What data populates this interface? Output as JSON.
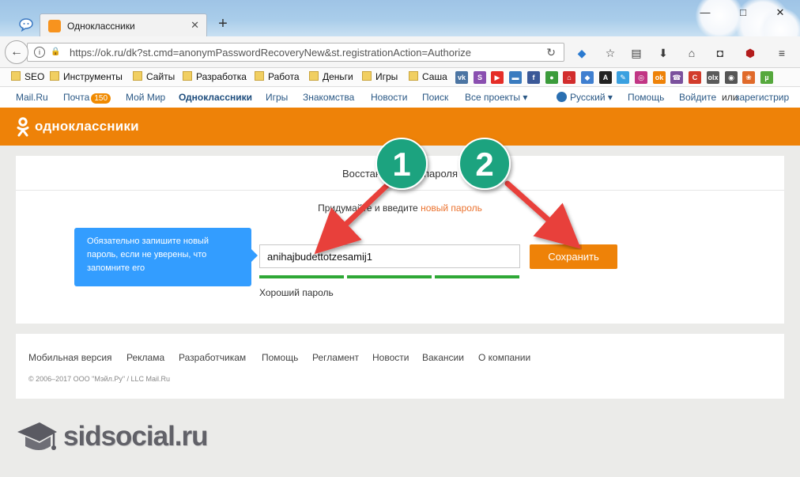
{
  "browser": {
    "tab_title": "Одноклассники",
    "url": "https://ok.ru/dk?st.cmd=anonymPasswordRecoveryNew&st.registrationAction=Authorize",
    "bookmarks": [
      {
        "label": "SEO"
      },
      {
        "label": "Инструменты"
      },
      {
        "label": "Сайты"
      },
      {
        "label": "Разработка"
      },
      {
        "label": "Работа"
      },
      {
        "label": "Деньги"
      },
      {
        "label": "Игры"
      },
      {
        "label": "Саша"
      }
    ],
    "bookmark_icons": [
      {
        "name": "vk-icon",
        "glyph": "vk",
        "color": "#4c75a3"
      },
      {
        "name": "skype-s-icon",
        "glyph": "S",
        "color": "#8a4fb0"
      },
      {
        "name": "youtube-icon",
        "glyph": "▶",
        "color": "#e52d27"
      },
      {
        "name": "card-icon",
        "glyph": "▬",
        "color": "#3a7bbf"
      },
      {
        "name": "facebook-icon",
        "glyph": "f",
        "color": "#3b5998"
      },
      {
        "name": "globe-green-icon",
        "glyph": "●",
        "color": "#3b9b3b"
      },
      {
        "name": "house-icon",
        "glyph": "⌂",
        "color": "#d22d2d"
      },
      {
        "name": "diamond-icon",
        "glyph": "◆",
        "color": "#3f7fd0"
      },
      {
        "name": "a-icon",
        "glyph": "A",
        "color": "#222222"
      },
      {
        "name": "pen-icon",
        "glyph": "✎",
        "color": "#3aa0e0"
      },
      {
        "name": "instagram-icon",
        "glyph": "◎",
        "color": "#c13584"
      },
      {
        "name": "ok-icon",
        "glyph": "ok",
        "color": "#ee8208"
      },
      {
        "name": "viber-icon",
        "glyph": "☎",
        "color": "#7b519d"
      },
      {
        "name": "c-icon",
        "glyph": "C",
        "color": "#d23c2c"
      },
      {
        "name": "olx-icon",
        "glyph": "olx",
        "color": "#5a5a5a"
      },
      {
        "name": "eye-icon",
        "glyph": "◉",
        "color": "#555555"
      },
      {
        "name": "paw-icon",
        "glyph": "❀",
        "color": "#e06a2a"
      },
      {
        "name": "utorrent-icon",
        "glyph": "µ",
        "color": "#56a83d"
      }
    ]
  },
  "mail_bar": {
    "mail_ru": "Mail.Ru",
    "pochta": "Почта",
    "pochta_count": "150",
    "moi_mir": "Мой Мир",
    "odnoklassniki": "Одноклассники",
    "igry": "Игры",
    "znakomstva": "Знакомства",
    "novosti": "Новости",
    "poisk": "Поиск",
    "vse_proekty": "Все проекты ▾",
    "language": "Русский ▾",
    "pomosch": "Помощь",
    "login": "Войдите",
    "or": "или",
    "register": "зарегистрир"
  },
  "header": {
    "logo_text": "одноклассники",
    "brand_color": "#ee8208"
  },
  "form": {
    "title": "Восстановление пароля",
    "subtitle_prefix": "Придумайте и введите ",
    "subtitle_accent": "новый пароль",
    "tooltip": "Обязательно запишите новый пароль, если не уверены, что запомните его",
    "password_value": "anihajbudettotzesamij1",
    "strength_label": "Хороший пароль",
    "save_button": "Сохранить"
  },
  "footer": {
    "links": [
      "Мобильная версия",
      "Реклама",
      "Разработчикам",
      "Помощь",
      "Регламент",
      "Новости",
      "Вакансии",
      "О компании"
    ],
    "copyright": "© 2006–2017 ООО \"Мэйл.Ру\" / LLC Mail.Ru"
  },
  "annotations": {
    "marker_1": "1",
    "marker_2": "2",
    "marker_color": "#1aa37f",
    "arrow_color": "#e8403a"
  },
  "watermark": {
    "text": "sidsocial.ru"
  }
}
